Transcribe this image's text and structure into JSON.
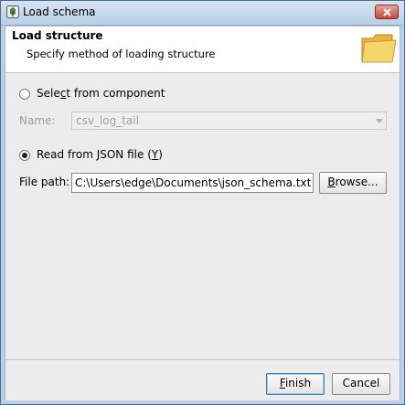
{
  "window": {
    "title": "Load schema"
  },
  "header": {
    "title": "Load structure",
    "subtitle": "Specify method of loading structure"
  },
  "component": {
    "radio_label_pre": "Sele",
    "radio_label_key": "c",
    "radio_label_post": "t from component",
    "name_label": "Name:",
    "name_value": "csv_log_tail"
  },
  "json": {
    "radio_label_pre": "Read from JSON file (",
    "radio_label_key": "Y",
    "radio_label_post": ")",
    "path_label": "File path:",
    "path_value": "C:\\Users\\edge\\Documents\\json_schema.txt",
    "browse_key": "B",
    "browse_rest": "rowse..."
  },
  "footer": {
    "finish_key": "F",
    "finish_rest": "inish",
    "cancel_label": "Cancel"
  },
  "colors": {
    "titlebar": "#b9cfe6",
    "close": "#c5483b",
    "folder": "#f5d66a"
  }
}
